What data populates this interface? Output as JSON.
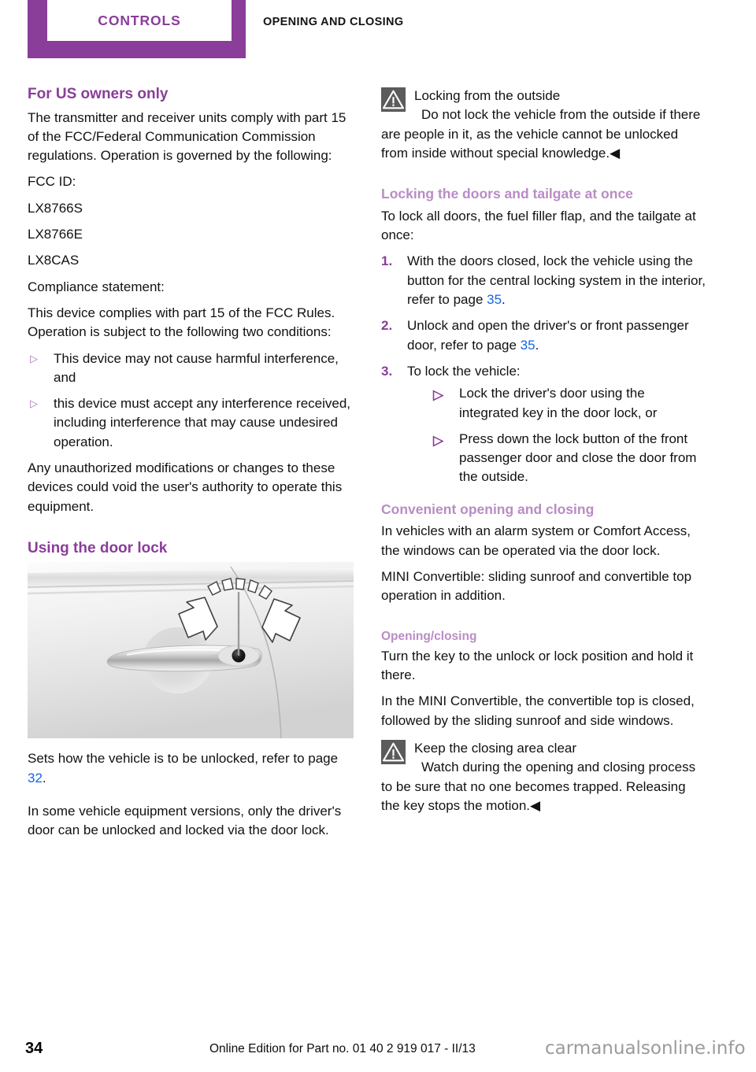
{
  "header": {
    "chapter_tab": "CONTROLS",
    "section_title": "OPENING AND CLOSING",
    "accent_purple": "#8a3d99",
    "subhead_purple": "#b98cc4"
  },
  "left_column": {
    "heading_us_owners": "For US owners only",
    "p_transmitter": "The transmitter and receiver units comply with part 15 of the FCC/Federal Communication Commission regulations. Operation is governed by the following:",
    "p_fcc_id_label": "FCC ID:",
    "fcc_ids": [
      "LX8766S",
      "LX8766E",
      "LX8CAS"
    ],
    "p_compliance_label": "Compliance statement:",
    "p_compliance_body": "This device complies with part 15 of the FCC Rules. Operation is subject to the following two conditions:",
    "compliance_bullets": [
      "This device may not cause harmful interference, and",
      "this device must accept any interference received, including interference that may cause undesired operation."
    ],
    "p_unauthorized": "Any unauthorized modifications or changes to these devices could void the user's authority to operate this equipment.",
    "heading_door_lock": "Using the door lock",
    "figure_caption": "car-door-handle-with-key-lock-illustration",
    "p_sets_how_pre": "Sets how the vehicle is to be unlocked, refer to page ",
    "p_sets_how_ref": "32",
    "p_sets_how_post": ".",
    "p_some_versions": "In some vehicle equipment versions, only the driver's door can be unlocked and locked via the door lock."
  },
  "right_column": {
    "warning_outside": {
      "icon": "warning-triangle-icon",
      "title": "Locking from the outside",
      "body": "Do not lock the vehicle from the outside if there are people in it, as the vehicle cannot be unlocked from inside without special knowledge.",
      "end_mark": "◀"
    },
    "heading_locking_once": "Locking the doors and tailgate at once",
    "p_to_lock_all": "To lock all doors, the fuel filler flap, and the tailgate at once:",
    "steps": [
      {
        "number": "1.",
        "text_pre": "With the doors closed, lock the vehicle using the button for the central locking system in the interior, refer to page ",
        "ref": "35",
        "text_post": "."
      },
      {
        "number": "2.",
        "text_pre": "Unlock and open the driver's or front passenger door, refer to page ",
        "ref": "35",
        "text_post": "."
      },
      {
        "number": "3.",
        "text_pre": "To lock the vehicle:",
        "ref": "",
        "text_post": "",
        "sub_bullets": [
          "Lock the driver's door using the integrated key in the door lock, or",
          "Press down the lock button of the front passenger door and close the door from the outside."
        ]
      }
    ],
    "heading_convenient": "Convenient opening and closing",
    "p_in_vehicles": "In vehicles with an alarm system or Comfort Access, the windows can be operated via the door lock.",
    "p_mini_convertible": "MINI Convertible: sliding sunroof and convertible top operation in addition.",
    "subheading_opening_closing": "Opening/closing",
    "p_turn_key": "Turn the key to the unlock or lock position and hold it there.",
    "p_in_mini": "In the MINI Convertible, the convertible top is closed, followed by the sliding sunroof and side windows.",
    "warning_closing_area": {
      "icon": "warning-triangle-icon",
      "title": "Keep the closing area clear",
      "body": "Watch during the opening and closing process to be sure that no one becomes trapped. Releasing the key stops the motion.",
      "end_mark": "◀"
    }
  },
  "footer": {
    "page_number": "34",
    "note": "Online Edition for Part no. 01 40 2 919 017 - II/13",
    "watermark": "carmanualsonline.info"
  },
  "bullet_glyph": "▷"
}
